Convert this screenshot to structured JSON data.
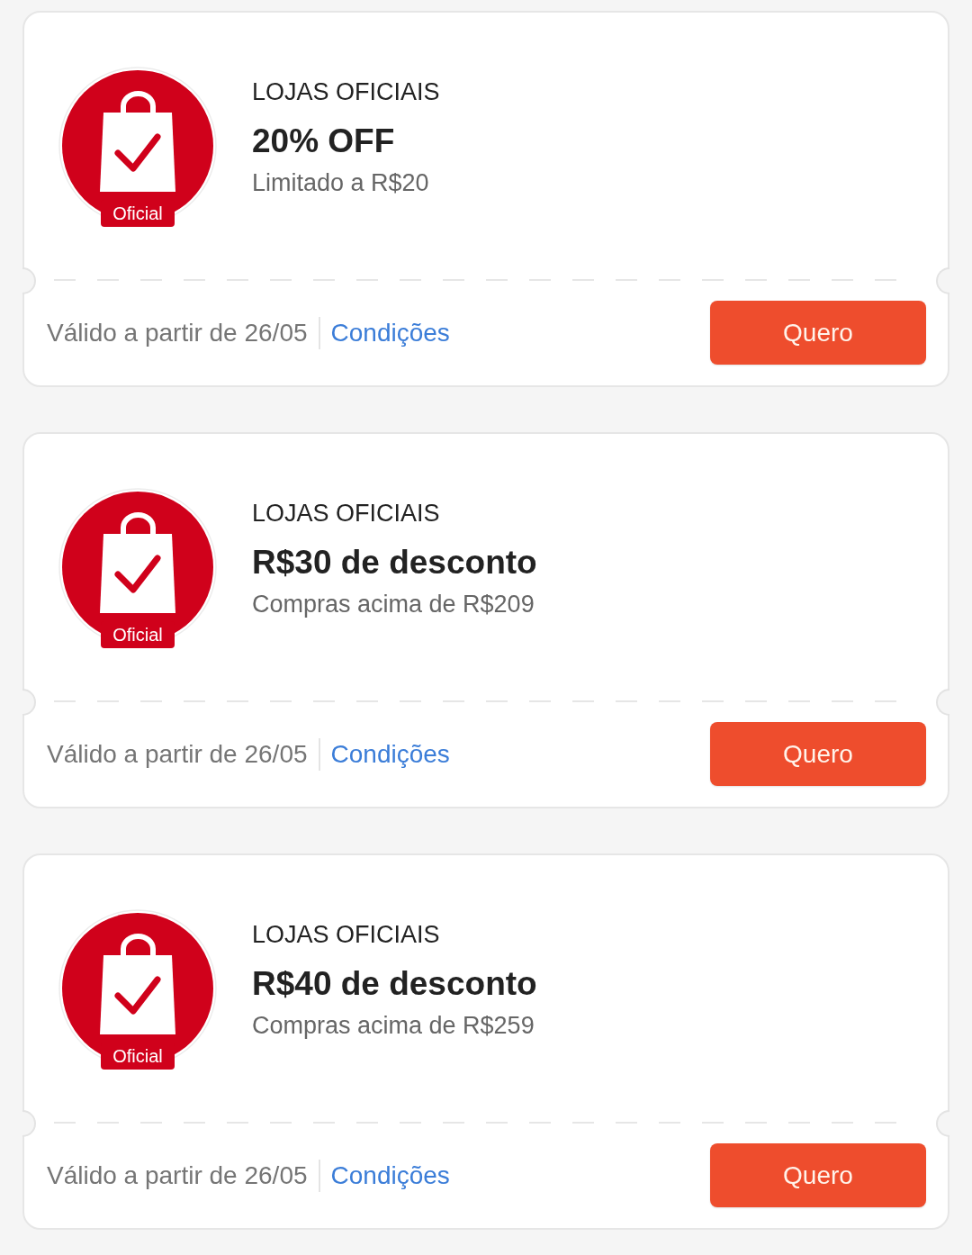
{
  "coupons": [
    {
      "logo_badge": "Oficial",
      "category": "LOJAS OFICIAIS",
      "title": "20% OFF",
      "subtitle": "Limitado a R$20",
      "validity": "Válido a partir de 26/05",
      "conditions_link": "Condições",
      "button": "Quero"
    },
    {
      "logo_badge": "Oficial",
      "category": "LOJAS OFICIAIS",
      "title": "R$30 de desconto",
      "subtitle": "Compras acima de R$209",
      "validity": "Válido a partir de 26/05",
      "conditions_link": "Condições",
      "button": "Quero"
    },
    {
      "logo_badge": "Oficial",
      "category": "LOJAS OFICIAIS",
      "title": "R$40 de desconto",
      "subtitle": "Compras acima de R$259",
      "validity": "Válido a partir de 26/05",
      "conditions_link": "Condições",
      "button": "Quero"
    }
  ]
}
